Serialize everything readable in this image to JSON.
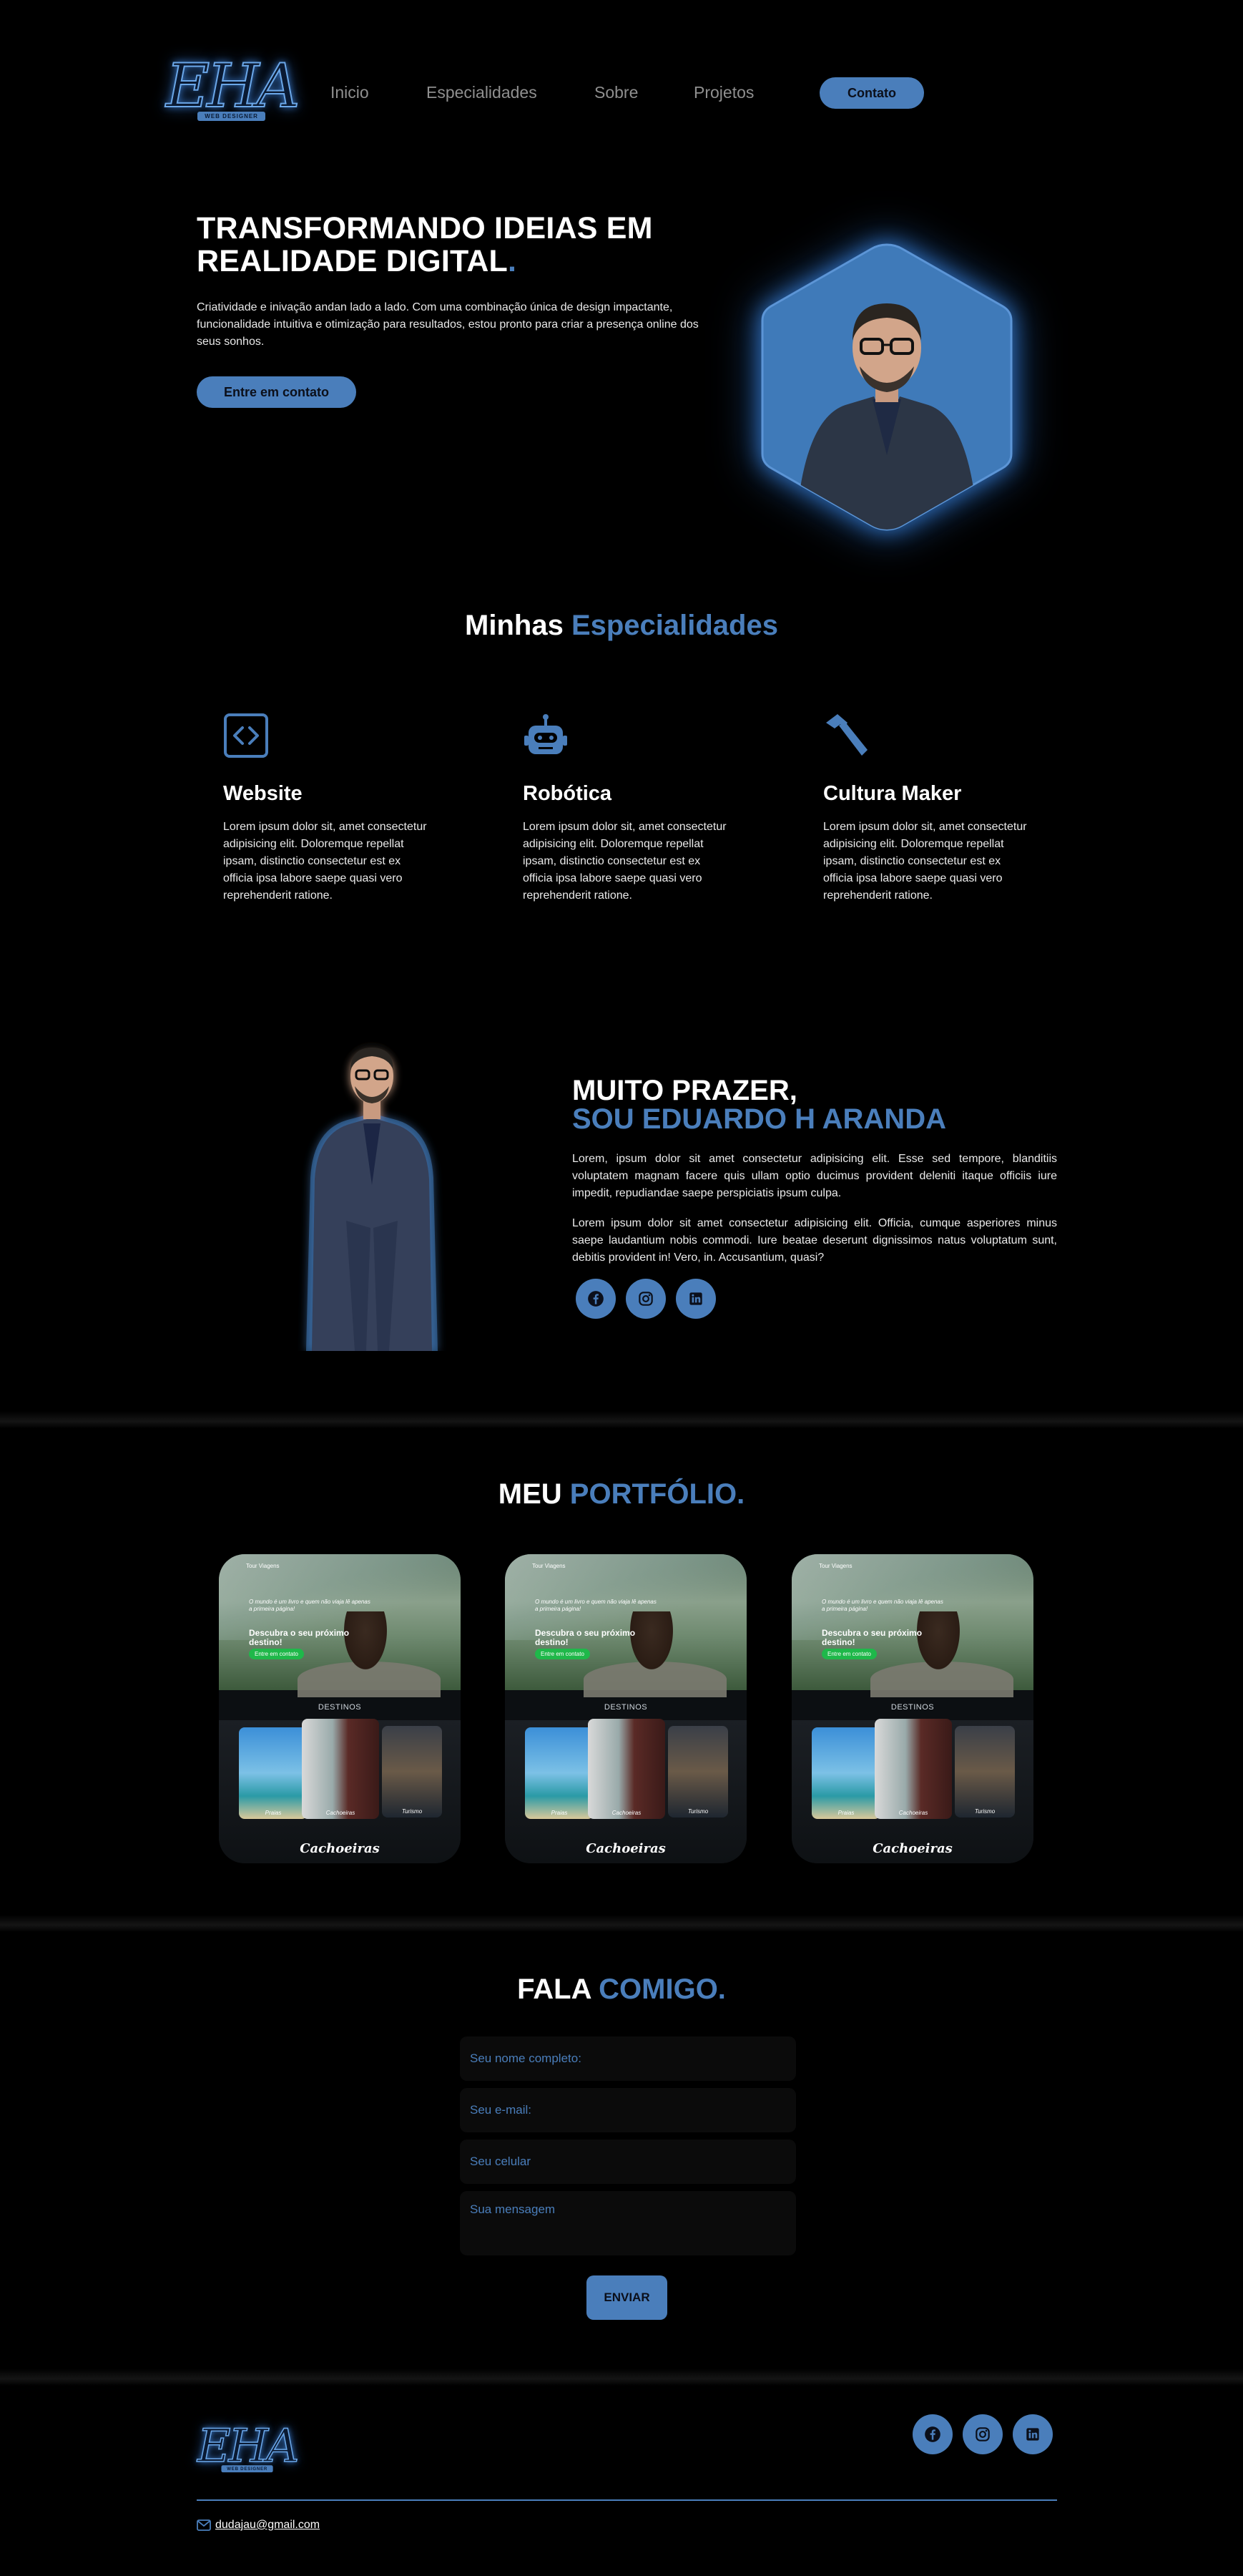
{
  "nav": {
    "logo_text": "EHA",
    "logo_tag": "WEB DESIGNER",
    "links": [
      "Inicio",
      "Especialidades",
      "Sobre",
      "Projetos"
    ],
    "contact_button": "Contato"
  },
  "hero": {
    "title_line1": "TRANSFORMANDO IDEIAS EM",
    "title_line2": "REALIDADE DIGITAL",
    "title_dot": ".",
    "text": "Criatividade e inivação andan lado a lado. Com uma combinação única de design impactante, funcionalidade intuitiva e otimização para resultados, estou pronto para criar a presença online dos seus sonhos.",
    "button": "Entre em contato"
  },
  "specialties": {
    "title_a": "Minhas",
    "title_b": "Especialidades",
    "items": [
      {
        "icon": "code-icon",
        "title": "Website",
        "text": "Lorem ipsum dolor sit, amet consectetur adipisicing elit. Doloremque repellat ipsam, distinctio consectetur est ex officia ipsa labore saepe quasi vero reprehenderit ratione."
      },
      {
        "icon": "robot-icon",
        "title": "Robótica",
        "text": "Lorem ipsum dolor sit, amet consectetur adipisicing elit. Doloremque repellat ipsam, distinctio consectetur est ex officia ipsa labore saepe quasi vero reprehenderit ratione."
      },
      {
        "icon": "hammer-icon",
        "title": "Cultura Maker",
        "text": "Lorem ipsum dolor sit, amet consectetur adipisicing elit. Doloremque repellat ipsam, distinctio consectetur est ex officia ipsa labore saepe quasi vero reprehenderit ratione."
      }
    ]
  },
  "about": {
    "heading1": "MUITO PRAZER,",
    "heading2": "SOU EDUARDO H ARANDA",
    "p1": "Lorem, ipsum dolor sit amet consectetur adipisicing elit. Esse sed tempore, blanditiis voluptatem magnam facere quis ullam optio ducimus provident deleniti itaque officiis iure impedit, repudiandae saepe perspiciatis ipsum culpa.",
    "p2": "Lorem ipsum dolor sit amet consectetur adipisicing elit. Officia, cumque asperiores minus saepe laudantium nobis commodi. Iure beatae deserunt dignissimos natus voluptatum sunt, debitis provident in! Vero, in. Accusantium, quasi?",
    "social": [
      "facebook-icon",
      "instagram-icon",
      "linkedin-icon"
    ]
  },
  "portfolio": {
    "title_a": "MEU",
    "title_b": "PORTFÓLIO.",
    "cards": [
      {
        "brand": "Tour Viagens",
        "quote": "O mundo é um livro e quem não viaja lê apenas a primeira página!",
        "headline": "Descubra o seu próximo destino!",
        "cta": "Entre em contato",
        "section": "DESTINOS",
        "photos": [
          "Praias",
          "Cachoeiras",
          "Turismo"
        ],
        "caption": "Cachoeiras"
      },
      {
        "brand": "Tour Viagens",
        "quote": "O mundo é um livro e quem não viaja lê apenas a primeira página!",
        "headline": "Descubra o seu próximo destino!",
        "cta": "Entre em contato",
        "section": "DESTINOS",
        "photos": [
          "Praias",
          "Cachoeiras",
          "Turismo"
        ],
        "caption": "Cachoeiras"
      },
      {
        "brand": "Tour Viagens",
        "quote": "O mundo é um livro e quem não viaja lê apenas a primeira página!",
        "headline": "Descubra o seu próximo destino!",
        "cta": "Entre em contato",
        "section": "DESTINOS",
        "photos": [
          "Praias",
          "Cachoeiras",
          "Turismo"
        ],
        "caption": "Cachoeiras"
      }
    ]
  },
  "contact": {
    "title_a": "FALA",
    "title_b": "COMIGO.",
    "name_placeholder": "Seu nome completo:",
    "email_placeholder": "Seu e-mail:",
    "phone_placeholder": "Seu celular",
    "message_placeholder": "Sua mensagem",
    "submit": "ENVIAR"
  },
  "footer": {
    "logo_text": "EHA",
    "logo_tag": "WEB DESIGNER",
    "email": "dudajau@gmail.com"
  },
  "colors": {
    "accent": "#4a7ebb",
    "background": "#000000"
  }
}
